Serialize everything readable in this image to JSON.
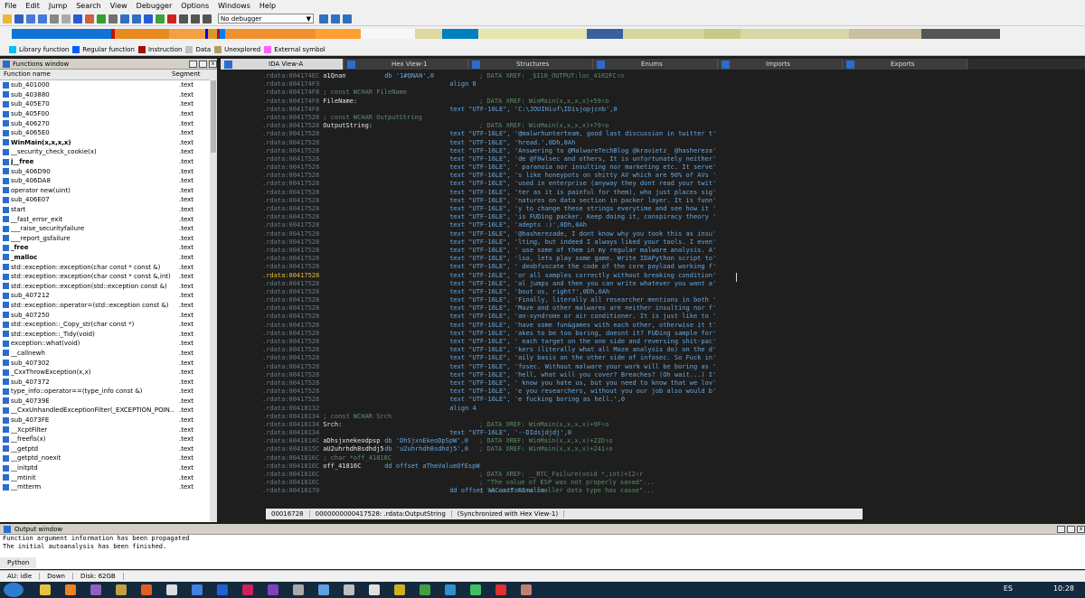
{
  "menu": [
    "File",
    "Edit",
    "Jump",
    "Search",
    "View",
    "Debugger",
    "Options",
    "Windows",
    "Help"
  ],
  "toolbar": {
    "debugger": "No debugger"
  },
  "legend": [
    {
      "label": "Library function",
      "color": "#00bfff"
    },
    {
      "label": "Regular function",
      "color": "#0060ff"
    },
    {
      "label": "Instruction",
      "color": "#a01010"
    },
    {
      "label": "Data",
      "color": "#c0c0c0"
    },
    {
      "label": "Unexplored",
      "color": "#b0a060"
    },
    {
      "label": "External symbol",
      "color": "#ff60ff"
    }
  ],
  "functions_window": {
    "title": "Functions window",
    "col_name": "Function name",
    "col_segment": "Segment",
    "rows": [
      [
        "sub_401000",
        ".text"
      ],
      [
        "sub_403880",
        ".text"
      ],
      [
        "sub_405E70",
        ".text"
      ],
      [
        "sub_405F00",
        ".text"
      ],
      [
        "sub_406270",
        ".text"
      ],
      [
        "sub_4065E0",
        ".text"
      ],
      [
        "WinMain(x,x,x,x)",
        ".text"
      ],
      [
        "__security_check_cookie(x)",
        ".text"
      ],
      [
        "j__free",
        ".text"
      ],
      [
        "sub_406D90",
        ".text"
      ],
      [
        "sub_406DA8",
        ".text"
      ],
      [
        "operator new(uint)",
        ".text"
      ],
      [
        "sub_406E07",
        ".text"
      ],
      [
        "start",
        ".text"
      ],
      [
        "__fast_error_exit",
        ".text"
      ],
      [
        "___raise_securityfailure",
        ".text"
      ],
      [
        "___report_gsfailure",
        ".text"
      ],
      [
        "_free",
        ".text"
      ],
      [
        "_malloc",
        ".text"
      ],
      [
        "std::exception::exception(char const * const &)",
        ".text"
      ],
      [
        "std::exception::exception(char const * const &,int)",
        ".text"
      ],
      [
        "std::exception::exception(std::exception const &)",
        ".text"
      ],
      [
        "sub_407212",
        ".text"
      ],
      [
        "std::exception::operator=(std::exception const &)",
        ".text"
      ],
      [
        "sub_407250",
        ".text"
      ],
      [
        "std::exception::_Copy_str(char const *)",
        ".text"
      ],
      [
        "std::exception::_Tidy(void)",
        ".text"
      ],
      [
        "exception::what(void)",
        ".text"
      ],
      [
        "__callnewh",
        ".text"
      ],
      [
        "sub_407302",
        ".text"
      ],
      [
        "_CxxThrowException(x,x)",
        ".text"
      ],
      [
        "sub_407372",
        ".text"
      ],
      [
        "type_info::operator==(type_info const &)",
        ".text"
      ],
      [
        "sub_40739E",
        ".text"
      ],
      [
        "__CxxUnhandledExceptionFilter(_EXCEPTION_POIN...",
        ".text"
      ],
      [
        "sub_4073FE",
        ".text"
      ],
      [
        "__XcptFilter",
        ".text"
      ],
      [
        "__freefls(x)",
        ".text"
      ],
      [
        "__getptd",
        ".text"
      ],
      [
        "__getptd_noexit",
        ".text"
      ],
      [
        "__initptd",
        ".text"
      ],
      [
        "__mtinit",
        ".text"
      ],
      [
        "__mtterm",
        ".text"
      ]
    ]
  },
  "tabs": [
    "IDA View-A",
    "Hex View-1",
    "Structures",
    "Enums",
    "Imports",
    "Exports"
  ],
  "code": [
    [
      ".rdata:004174EC",
      "a1Qnan",
      "",
      "db '1#QNAN',0",
      "; DATA XREF: _$I10_OUTPUT:loc_4102FC↑o"
    ],
    [
      ".rdata:004174F3",
      "",
      "",
      "align 8",
      ""
    ],
    [
      ".rdata:004174F8",
      "; const WCHAR FileName",
      "",
      "",
      ""
    ],
    [
      ".rdata:004174F8",
      "FileName:",
      "",
      "",
      "; DATA XREF: WinMain(x,x,x,x)+59↑o"
    ],
    [
      ".rdata:004174F8",
      "",
      "",
      "text \"UTF-16LE\", 'C:\\JOUIHiuf\\IDisjopjcnb',0",
      ""
    ],
    [
      ".rdata:00417528",
      "; const WCHAR OutputString",
      "",
      "",
      ""
    ],
    [
      ".rdata:00417528",
      "OutputString:",
      "",
      "",
      "; DATA XREF: WinMain(x,x,x,x)+79↑o"
    ],
    [
      ".rdata:00417528",
      "",
      "",
      "text \"UTF-16LE\", '@malwrhunterteam, good last discussion in twitter t'",
      ""
    ],
    [
      ".rdata:00417528",
      "",
      "",
      "text \"UTF-16LE\", 'hread.',0Dh,0Ah",
      ""
    ],
    [
      ".rdata:00417528",
      "",
      "",
      "text \"UTF-16LE\", 'Answering to @MalwareTechBlog @kravietz_ @hashereza'",
      ""
    ],
    [
      ".rdata:00417528",
      "",
      "",
      "text \"UTF-16LE\", 'de @f0wlsec and others, It is unfortunately neither'",
      ""
    ],
    [
      ".rdata:00417528",
      "",
      "",
      "text \"UTF-16LE\", ' paranoia nor insulting nor marketing etc. It serve'",
      ""
    ],
    [
      ".rdata:00417528",
      "",
      "",
      "text \"UTF-16LE\", 's like honeypots on shitty AV which are 90% of AVs '",
      ""
    ],
    [
      ".rdata:00417528",
      "",
      "",
      "text \"UTF-16LE\", 'used in enterprise (anyway they dont read your twit'",
      ""
    ],
    [
      ".rdata:00417528",
      "",
      "",
      "text \"UTF-16LE\", 'ter as it is painful for them), who just places sig'",
      ""
    ],
    [
      ".rdata:00417528",
      "",
      "",
      "text \"UTF-16LE\", 'natures on data section in packer layer. It is funn'",
      ""
    ],
    [
      ".rdata:00417528",
      "",
      "",
      "text \"UTF-16LE\", 'y to change these strings everytime and see how it '",
      ""
    ],
    [
      ".rdata:00417528",
      "",
      "",
      "text \"UTF-16LE\", 'is FUDing packer. Keep doing it, conspiracy theory '",
      ""
    ],
    [
      ".rdata:00417528",
      "",
      "",
      "text \"UTF-16LE\", 'adepts :)',0Dh,0Ah",
      ""
    ],
    [
      ".rdata:00417528",
      "",
      "",
      "text \"UTF-16LE\", '@hasherezade, I dont know why you took this as insu'",
      ""
    ],
    [
      ".rdata:00417528",
      "",
      "",
      "text \"UTF-16LE\", 'lting, but indeed I always liked your tools. I even'",
      ""
    ],
    [
      ".rdata:00417528",
      "",
      "",
      "text \"UTF-16LE\", ' use some of them in my regular malware analysis. A'",
      ""
    ],
    [
      ".rdata:00417528",
      "",
      "",
      "text \"UTF-16LE\", 'lso, lets play some game. Write IDAPython script to'",
      ""
    ],
    [
      ".rdata:00417528",
      "",
      "",
      "text \"UTF-16LE\", ' deobfuscate the code of the core payload working f'",
      ""
    ],
    [
      ".rdata:00417528",
      "",
      "",
      "text \"UTF-16LE\", 'or all samples correctly without breaking condition'",
      ""
    ],
    [
      ".rdata:00417528",
      "",
      "",
      "text \"UTF-16LE\", 'al jumps and then you can write whatever you want a'",
      ""
    ],
    [
      ".rdata:00417528",
      "",
      "",
      "text \"UTF-16LE\", 'bout us, right?',0Dh,0Ah",
      ""
    ],
    [
      ".rdata:00417528",
      "",
      "",
      "text \"UTF-16LE\", 'Finally, literally all researcher mentions in both '",
      ""
    ],
    [
      ".rdata:00417528",
      "",
      "",
      "text \"UTF-16LE\", 'Maze and other malwares are neither insulting nor f'",
      ""
    ],
    [
      ".rdata:00417528",
      "",
      "",
      "text \"UTF-16LE\", 'an-syndrome or air conditioner. It is just like to '",
      ""
    ],
    [
      ".rdata:00417528",
      "",
      "",
      "text \"UTF-16LE\", 'have some fun&games with each other, otherwise it t'",
      ""
    ],
    [
      ".rdata:00417528",
      "",
      "",
      "text \"UTF-16LE\", 'akes to be too boring, doesnt it? FUDing sample for'",
      ""
    ],
    [
      ".rdata:00417528",
      "",
      "",
      "text \"UTF-16LE\", ' each target on the one side and reversing shit-pac'",
      ""
    ],
    [
      ".rdata:00417528",
      "",
      "",
      "text \"UTF-16LE\", 'kers (literally what all Maze analysis do) on the d'",
      ""
    ],
    [
      ".rdata:00417528",
      "",
      "",
      "text \"UTF-16LE\", 'aily basis on the other side of infosec. So Fuck in'",
      ""
    ],
    [
      ".rdata:00417528",
      "",
      "",
      "text \"UTF-16LE\", 'fosec. Without malware your work will be boring as '",
      ""
    ],
    [
      ".rdata:00417528",
      "",
      "",
      "text \"UTF-16LE\", 'hell, what will you cover? Breaches? (Oh wait...) I'",
      ""
    ],
    [
      ".rdata:00417528",
      "",
      "",
      "text \"UTF-16LE\", ' know you hate us, but you need to know that we lov'",
      ""
    ],
    [
      ".rdata:00417528",
      "",
      "",
      "text \"UTF-16LE\", 'e you researchers, without you our job also would b'",
      ""
    ],
    [
      ".rdata:00417528",
      "",
      "",
      "text \"UTF-16LE\", 'e fucking boring as hell.',0",
      ""
    ],
    [
      ".rdata:00418132",
      "",
      "",
      "align 4",
      ""
    ],
    [
      ".rdata:00418134",
      "; const WCHAR Srch",
      "",
      "",
      ""
    ],
    [
      ".rdata:00418134",
      "Srch:",
      "",
      "",
      "; DATA XREF: WinMain(x,x,x,x)+9F↑o"
    ],
    [
      ".rdata:00418134",
      "",
      "",
      "text \"UTF-16LE\", '--DIdsjdjdj',0",
      ""
    ],
    [
      ".rdata:0041814C",
      "aDhsjxnekeodpsp",
      "",
      "db 'DhSjxnEkeoDpSpW',0",
      "; DATA XREF: WinMain(x,x,x,x)+22D↑o"
    ],
    [
      ".rdata:0041815C",
      "aU2uhrhdh8sdhdj5",
      "",
      "db 'u2uhrhdh8sdhdj5',0",
      "; DATA XREF: WinMain(x,x,x,x)+241↑o"
    ],
    [
      ".rdata:0041816C",
      "; char *off_41816C",
      "",
      "",
      ""
    ],
    [
      ".rdata:0041816C",
      "off_41816C",
      "",
      "dd offset aTheValueOfEspW",
      ""
    ],
    [
      ".rdata:0041816C",
      "",
      "",
      "",
      "; DATA XREF: __RTC_Failure(void *,int)+12↑r"
    ],
    [
      ".rdata:0041816C",
      "",
      "",
      "",
      "; \"The value of ESP was not properly saved\"..."
    ],
    [
      ".rdata:00418170",
      "",
      "",
      "dd offset aACastToASmalle",
      "; \"A cast to a smaller data type has cause\"..."
    ]
  ],
  "highlight_row": 24,
  "status": [
    "00016728",
    "0000000000417528: .rdata:OutputString",
    "(Synchronized with Hex View-1)"
  ],
  "output_window": {
    "title": "Output window",
    "lines": [
      "Function argument information has been propagated",
      "The initial autoanalysis has been finished."
    ],
    "tab": "Python"
  },
  "statusline": [
    "AU: idle",
    "Down",
    "Disk: 62GB"
  ],
  "taskbar": {
    "lang": "ES",
    "time": "10:28"
  }
}
